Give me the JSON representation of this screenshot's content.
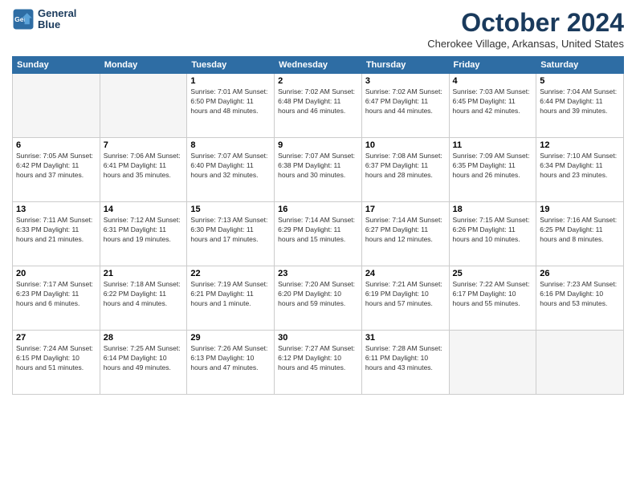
{
  "logo": {
    "line1": "General",
    "line2": "Blue"
  },
  "title": "October 2024",
  "location": "Cherokee Village, Arkansas, United States",
  "weekdays": [
    "Sunday",
    "Monday",
    "Tuesday",
    "Wednesday",
    "Thursday",
    "Friday",
    "Saturday"
  ],
  "weeks": [
    [
      {
        "day": "",
        "info": ""
      },
      {
        "day": "",
        "info": ""
      },
      {
        "day": "1",
        "info": "Sunrise: 7:01 AM\nSunset: 6:50 PM\nDaylight: 11 hours and 48 minutes."
      },
      {
        "day": "2",
        "info": "Sunrise: 7:02 AM\nSunset: 6:48 PM\nDaylight: 11 hours and 46 minutes."
      },
      {
        "day": "3",
        "info": "Sunrise: 7:02 AM\nSunset: 6:47 PM\nDaylight: 11 hours and 44 minutes."
      },
      {
        "day": "4",
        "info": "Sunrise: 7:03 AM\nSunset: 6:45 PM\nDaylight: 11 hours and 42 minutes."
      },
      {
        "day": "5",
        "info": "Sunrise: 7:04 AM\nSunset: 6:44 PM\nDaylight: 11 hours and 39 minutes."
      }
    ],
    [
      {
        "day": "6",
        "info": "Sunrise: 7:05 AM\nSunset: 6:42 PM\nDaylight: 11 hours and 37 minutes."
      },
      {
        "day": "7",
        "info": "Sunrise: 7:06 AM\nSunset: 6:41 PM\nDaylight: 11 hours and 35 minutes."
      },
      {
        "day": "8",
        "info": "Sunrise: 7:07 AM\nSunset: 6:40 PM\nDaylight: 11 hours and 32 minutes."
      },
      {
        "day": "9",
        "info": "Sunrise: 7:07 AM\nSunset: 6:38 PM\nDaylight: 11 hours and 30 minutes."
      },
      {
        "day": "10",
        "info": "Sunrise: 7:08 AM\nSunset: 6:37 PM\nDaylight: 11 hours and 28 minutes."
      },
      {
        "day": "11",
        "info": "Sunrise: 7:09 AM\nSunset: 6:35 PM\nDaylight: 11 hours and 26 minutes."
      },
      {
        "day": "12",
        "info": "Sunrise: 7:10 AM\nSunset: 6:34 PM\nDaylight: 11 hours and 23 minutes."
      }
    ],
    [
      {
        "day": "13",
        "info": "Sunrise: 7:11 AM\nSunset: 6:33 PM\nDaylight: 11 hours and 21 minutes."
      },
      {
        "day": "14",
        "info": "Sunrise: 7:12 AM\nSunset: 6:31 PM\nDaylight: 11 hours and 19 minutes."
      },
      {
        "day": "15",
        "info": "Sunrise: 7:13 AM\nSunset: 6:30 PM\nDaylight: 11 hours and 17 minutes."
      },
      {
        "day": "16",
        "info": "Sunrise: 7:14 AM\nSunset: 6:29 PM\nDaylight: 11 hours and 15 minutes."
      },
      {
        "day": "17",
        "info": "Sunrise: 7:14 AM\nSunset: 6:27 PM\nDaylight: 11 hours and 12 minutes."
      },
      {
        "day": "18",
        "info": "Sunrise: 7:15 AM\nSunset: 6:26 PM\nDaylight: 11 hours and 10 minutes."
      },
      {
        "day": "19",
        "info": "Sunrise: 7:16 AM\nSunset: 6:25 PM\nDaylight: 11 hours and 8 minutes."
      }
    ],
    [
      {
        "day": "20",
        "info": "Sunrise: 7:17 AM\nSunset: 6:23 PM\nDaylight: 11 hours and 6 minutes."
      },
      {
        "day": "21",
        "info": "Sunrise: 7:18 AM\nSunset: 6:22 PM\nDaylight: 11 hours and 4 minutes."
      },
      {
        "day": "22",
        "info": "Sunrise: 7:19 AM\nSunset: 6:21 PM\nDaylight: 11 hours and 1 minute."
      },
      {
        "day": "23",
        "info": "Sunrise: 7:20 AM\nSunset: 6:20 PM\nDaylight: 10 hours and 59 minutes."
      },
      {
        "day": "24",
        "info": "Sunrise: 7:21 AM\nSunset: 6:19 PM\nDaylight: 10 hours and 57 minutes."
      },
      {
        "day": "25",
        "info": "Sunrise: 7:22 AM\nSunset: 6:17 PM\nDaylight: 10 hours and 55 minutes."
      },
      {
        "day": "26",
        "info": "Sunrise: 7:23 AM\nSunset: 6:16 PM\nDaylight: 10 hours and 53 minutes."
      }
    ],
    [
      {
        "day": "27",
        "info": "Sunrise: 7:24 AM\nSunset: 6:15 PM\nDaylight: 10 hours and 51 minutes."
      },
      {
        "day": "28",
        "info": "Sunrise: 7:25 AM\nSunset: 6:14 PM\nDaylight: 10 hours and 49 minutes."
      },
      {
        "day": "29",
        "info": "Sunrise: 7:26 AM\nSunset: 6:13 PM\nDaylight: 10 hours and 47 minutes."
      },
      {
        "day": "30",
        "info": "Sunrise: 7:27 AM\nSunset: 6:12 PM\nDaylight: 10 hours and 45 minutes."
      },
      {
        "day": "31",
        "info": "Sunrise: 7:28 AM\nSunset: 6:11 PM\nDaylight: 10 hours and 43 minutes."
      },
      {
        "day": "",
        "info": ""
      },
      {
        "day": "",
        "info": ""
      }
    ]
  ]
}
